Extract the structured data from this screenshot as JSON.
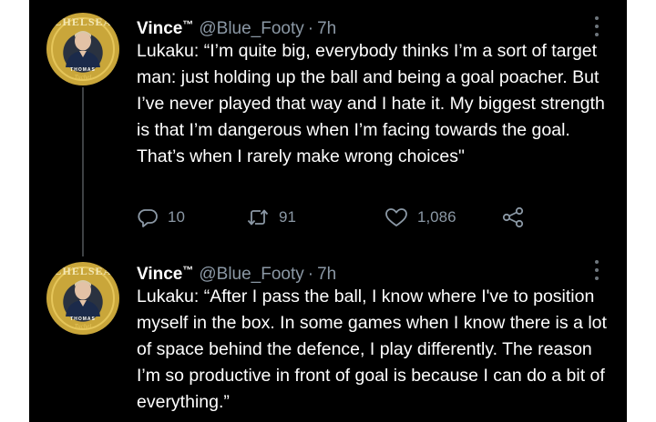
{
  "tweets": [
    {
      "display_name": "Vince",
      "trademark": "™",
      "handle": "@Blue_Footy",
      "separator": "·",
      "time": "7h",
      "text": "Lukaku: “I’m quite big, everybody thinks I’m a sort of target man: just holding up the ball and being a goal poacher. But I’ve never played that way and I hate it. My biggest strength is that I’m dangerous when I’m facing towards the goal. That’s when I rarely make wrong choices\"",
      "reply_count": "10",
      "retweet_count": "91",
      "like_count": "1,086"
    },
    {
      "display_name": "Vince",
      "trademark": "™",
      "handle": "@Blue_Footy",
      "separator": "·",
      "time": "7h",
      "text": "Lukaku: “After I pass the ball, I know where I've to position myself in the box. In some games when I know there is a lot of space behind the defence, I play differently. The reason I’m so productive in front of goal is because I can do a bit of everything.”"
    }
  ],
  "avatar": {
    "arc_text": "CHELSEA",
    "name_text": "THOMAS",
    "signature": "Tuchel"
  },
  "icons": {
    "more": "more-vertical-icon",
    "reply": "reply-icon",
    "retweet": "retweet-icon",
    "like": "heart-icon",
    "share": "share-icon"
  },
  "colors": {
    "background": "#000000",
    "text": "#ffffff",
    "secondary": "#8b98a5",
    "avatar_gold": "#c9a63a",
    "avatar_navy": "#2a3240"
  }
}
